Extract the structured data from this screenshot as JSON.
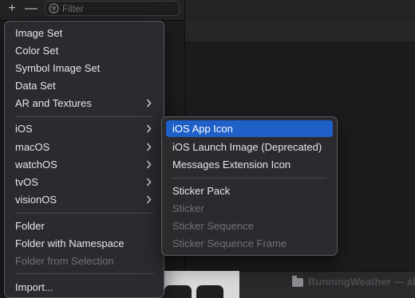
{
  "toolbar": {
    "add_label": "+",
    "remove_label": "—",
    "filter_placeholder": "Filter"
  },
  "window": {
    "title": "RunningWeather — al"
  },
  "main_menu": {
    "items": [
      {
        "label": "Image Set"
      },
      {
        "label": "Color Set"
      },
      {
        "label": "Symbol Image Set"
      },
      {
        "label": "Data Set"
      },
      {
        "label": "AR and Textures",
        "submenu": true
      },
      {
        "label": "iOS",
        "submenu": true,
        "state": "open"
      },
      {
        "label": "macOS",
        "submenu": true
      },
      {
        "label": "watchOS",
        "submenu": true
      },
      {
        "label": "tvOS",
        "submenu": true
      },
      {
        "label": "visionOS",
        "submenu": true
      },
      {
        "label": "Folder"
      },
      {
        "label": "Folder with Namespace"
      },
      {
        "label": "Folder from Selection",
        "disabled": true
      },
      {
        "label": "Import..."
      }
    ]
  },
  "ios_submenu": {
    "items": [
      {
        "label": "iOS App Icon",
        "highlighted": true
      },
      {
        "label": "iOS Launch Image (Deprecated)"
      },
      {
        "label": "Messages Extension Icon"
      },
      {
        "label": "Sticker Pack"
      },
      {
        "label": "Sticker",
        "disabled": true
      },
      {
        "label": "Sticker Sequence",
        "disabled": true
      },
      {
        "label": "Sticker Sequence Frame",
        "disabled": true
      }
    ]
  },
  "colors": {
    "highlight": "#1e5fc8",
    "menu_bg": "#2c2c2f",
    "text": "#e6e6e8",
    "disabled_text": "#717175"
  },
  "icons": {
    "chevron": "chevron-right-icon",
    "filter": "filter-icon",
    "folder": "folder-icon"
  }
}
